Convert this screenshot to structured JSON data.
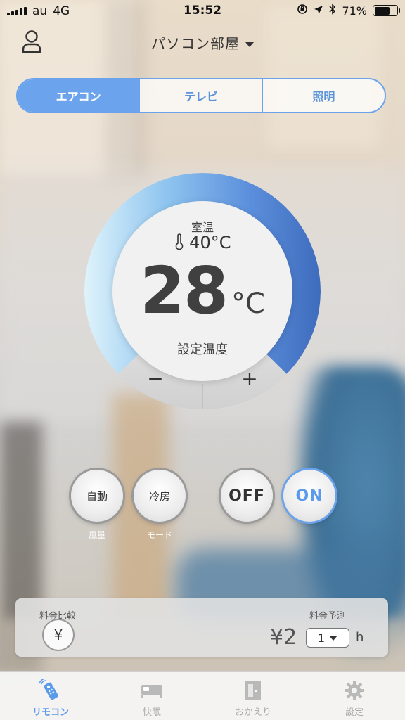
{
  "status_bar": {
    "carrier": "au",
    "network": "4G",
    "time": "15:52",
    "battery": "71%"
  },
  "header": {
    "room_title": "パソコン部屋"
  },
  "tabs": [
    {
      "label": "エアコン",
      "active": true
    },
    {
      "label": "テレビ",
      "active": false
    },
    {
      "label": "照明",
      "active": false
    }
  ],
  "dial": {
    "room_label": "室温",
    "room_temp": "40°C",
    "set_temp": "28",
    "set_unit": "°C",
    "set_label": "設定温度",
    "minus": "−",
    "plus": "+"
  },
  "controls": {
    "fan_button": "自動",
    "fan_caption": "風量",
    "mode_button": "冷房",
    "mode_caption": "モード",
    "off_button": "OFF",
    "on_button": "ON"
  },
  "fee": {
    "compare_label": "料金比較",
    "yen_symbol": "¥",
    "forecast_label": "料金予測",
    "amount": "¥2",
    "hours_value": "1",
    "hours_unit": "h"
  },
  "tabbar": [
    {
      "label": "リモコン",
      "icon": "remote-icon",
      "active": true
    },
    {
      "label": "快眠",
      "icon": "bed-icon",
      "active": false
    },
    {
      "label": "おかえり",
      "icon": "door-icon",
      "active": false
    },
    {
      "label": "設定",
      "icon": "gear-icon",
      "active": false
    }
  ],
  "colors": {
    "accent": "#6ba4ec",
    "ring_light": "#dff1fb",
    "ring_dark": "#3f6fc0"
  }
}
